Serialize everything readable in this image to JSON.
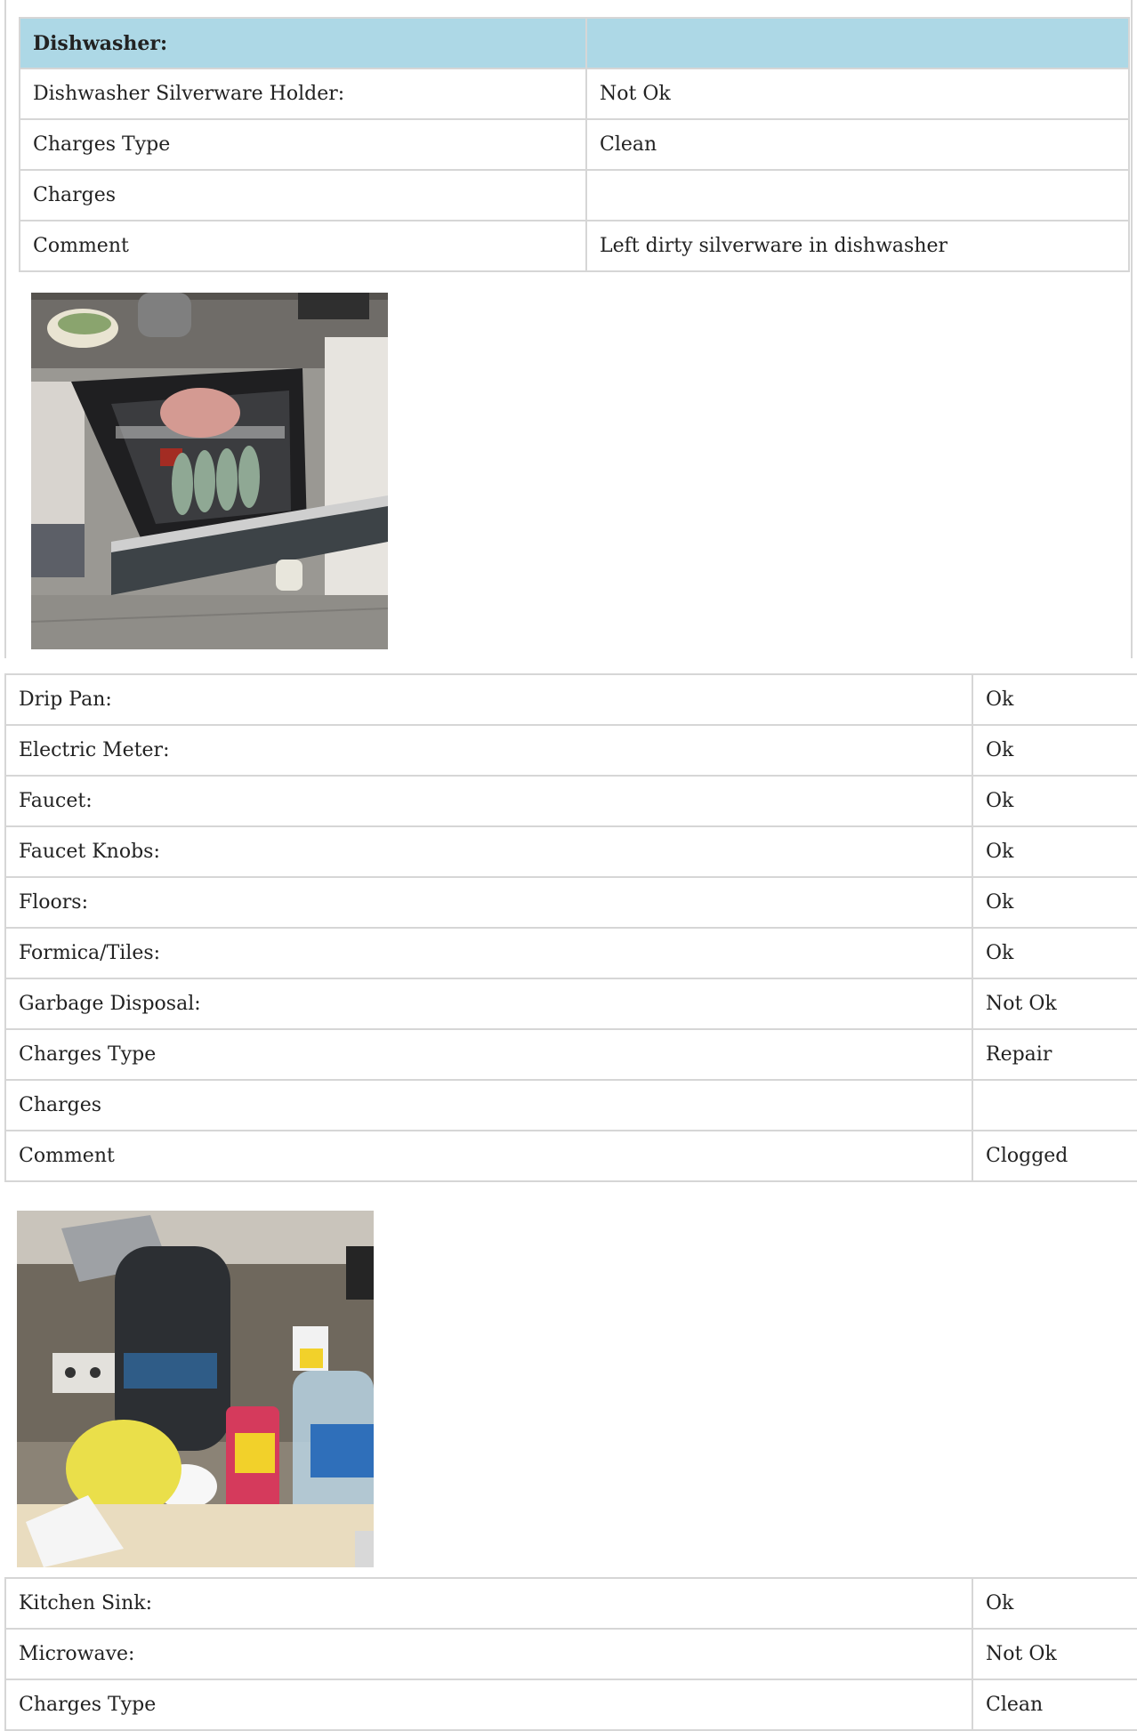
{
  "dishwasher": {
    "header": "Dishwasher:",
    "rows": [
      {
        "label": "Dishwasher Silverware Holder:",
        "value": "Not Ok"
      },
      {
        "label": "Charges Type",
        "value": "Clean"
      },
      {
        "label": "Charges",
        "value": ""
      },
      {
        "label": "Comment",
        "value": "Left dirty silverware in dishwasher"
      }
    ]
  },
  "items": [
    {
      "label": "Drip Pan:",
      "value": "Ok"
    },
    {
      "label": "Electric Meter:",
      "value": "Ok"
    },
    {
      "label": "Faucet:",
      "value": "Ok"
    },
    {
      "label": "Faucet Knobs:",
      "value": "Ok"
    },
    {
      "label": "Floors:",
      "value": "Ok"
    },
    {
      "label": "Formica/Tiles:",
      "value": "Ok"
    },
    {
      "label": "Garbage Disposal:",
      "value": "Not Ok"
    },
    {
      "label": "Charges Type",
      "value": "Repair"
    },
    {
      "label": "Charges",
      "value": ""
    },
    {
      "label": "Comment",
      "value": "Clogged"
    }
  ],
  "items2": [
    {
      "label": "Kitchen Sink:",
      "value": "Ok"
    },
    {
      "label": "Microwave:",
      "value": "Not Ok"
    },
    {
      "label": "Charges Type",
      "value": "Clean"
    }
  ]
}
